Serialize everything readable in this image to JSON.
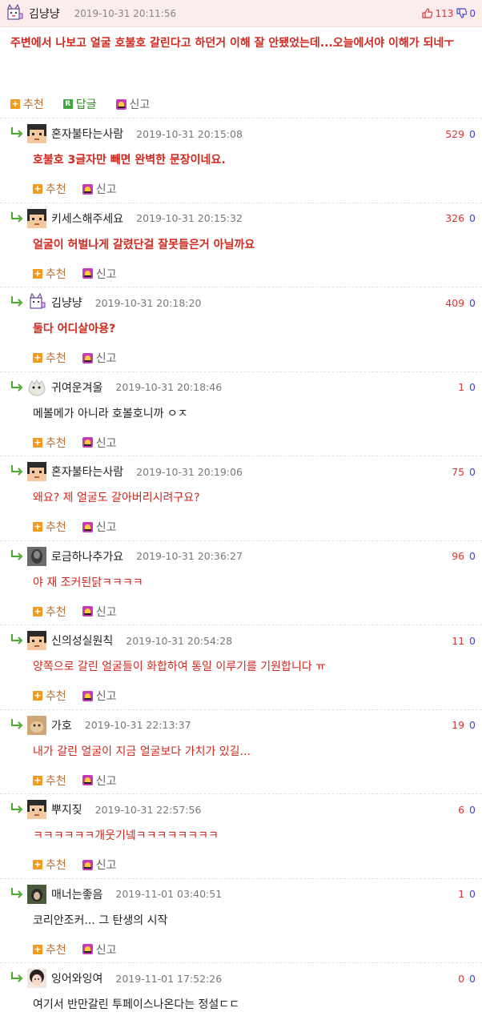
{
  "main": {
    "nickname": "김냥냥",
    "datetime": "2019-10-31 20:11:56",
    "upvotes": "113",
    "downvotes": "0",
    "body": "주변에서 나보고 얼굴 호불호 갈린다고 하던거 이해 잘 안됐었는데...오늘에서야 이해가 되네ㅜ",
    "actions": {
      "recommend": "추천",
      "reply": "답글",
      "report": "신고"
    }
  },
  "reply_actions": {
    "recommend": "추천",
    "report": "신고"
  },
  "replies": [
    {
      "nickname": "혼자불타는사람",
      "datetime": "2019-10-31 20:15:08",
      "up": "529",
      "down": "0",
      "body": "호불호 3글자만 빼면 완벽한 문장이네요.",
      "style": "red bold",
      "avatar": "pixel-man"
    },
    {
      "nickname": "키세스해주세요",
      "datetime": "2019-10-31 20:15:32",
      "up": "326",
      "down": "0",
      "body": "얼굴이 허벌나게 갈렸단걸 잘못들은거 아닐까요",
      "style": "red bold",
      "avatar": "pixel-man"
    },
    {
      "nickname": "김냥냥",
      "datetime": "2019-10-31 20:18:20",
      "up": "409",
      "down": "0",
      "body": "둘다 어디살아용?",
      "style": "red bold",
      "avatar": "cat"
    },
    {
      "nickname": "귀여운겨울",
      "datetime": "2019-10-31 20:18:46",
      "up": "1",
      "down": "0",
      "body": "메볼메가 아니라 호볼호니까 ㅇㅈ",
      "style": "dark",
      "avatar": "fluff"
    },
    {
      "nickname": "혼자불타는사람",
      "datetime": "2019-10-31 20:19:06",
      "up": "75",
      "down": "0",
      "body": "왜요? 제 얼굴도 갈아버리시려구요?",
      "style": "red",
      "avatar": "pixel-man"
    },
    {
      "nickname": "로금하나추가요",
      "datetime": "2019-10-31 20:36:27",
      "up": "96",
      "down": "0",
      "body": "야 재 조커된닭ㅋㅋㅋㅋ",
      "style": "red",
      "avatar": "photo-dark"
    },
    {
      "nickname": "신의성실원칙",
      "datetime": "2019-10-31 20:54:28",
      "up": "11",
      "down": "0",
      "body": "양쪽으로 갈린 얼굴들이 화합하여 통일 이루기를 기원합니다 ㅠ",
      "style": "red",
      "avatar": "pixel-man"
    },
    {
      "nickname": "가호",
      "datetime": "2019-10-31 22:13:37",
      "up": "19",
      "down": "0",
      "body": "내가 갈린 얼굴이 지금 얼굴보다 가치가 있길...",
      "style": "red",
      "avatar": "photo-tan"
    },
    {
      "nickname": "뿌지짖",
      "datetime": "2019-10-31 22:57:56",
      "up": "6",
      "down": "0",
      "body": "ㅋㅋㅋㅋㅋㅋ개웃기넼ㅋㅋㅋㅋㅋㅋㅋㅋ",
      "style": "red",
      "avatar": "pixel-man"
    },
    {
      "nickname": "매너는좋음",
      "datetime": "2019-11-01 03:40:51",
      "up": "1",
      "down": "0",
      "body": "코리안조커... 그 탄생의 시작",
      "style": "dark",
      "avatar": "photo-green"
    },
    {
      "nickname": "잉어와잉여",
      "datetime": "2019-11-01 17:52:26",
      "up": "0",
      "down": "0",
      "body": "여기서 반만갈린 투페이스나온다는 정설ㄷㄷ",
      "style": "dark",
      "avatar": "photo-face"
    }
  ]
}
